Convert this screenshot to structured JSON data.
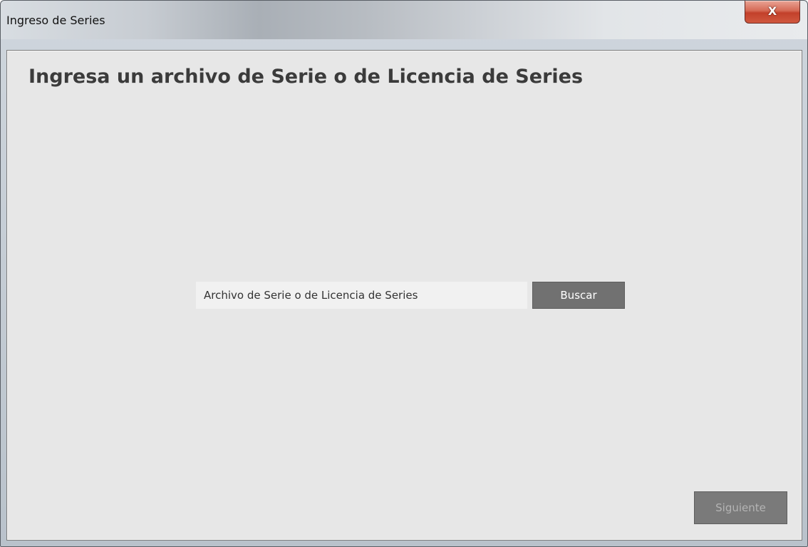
{
  "window": {
    "title": "Ingreso de Series",
    "close_glyph": "X"
  },
  "main": {
    "heading": "Ingresa un archivo de Serie o de Licencia de Series",
    "file_input": {
      "value": "",
      "placeholder": "Archivo de Serie o de Licencia de Series"
    },
    "browse_label": "Buscar",
    "next_label": "Siguiente",
    "next_enabled": false
  },
  "icons": {
    "close": "close-icon"
  }
}
